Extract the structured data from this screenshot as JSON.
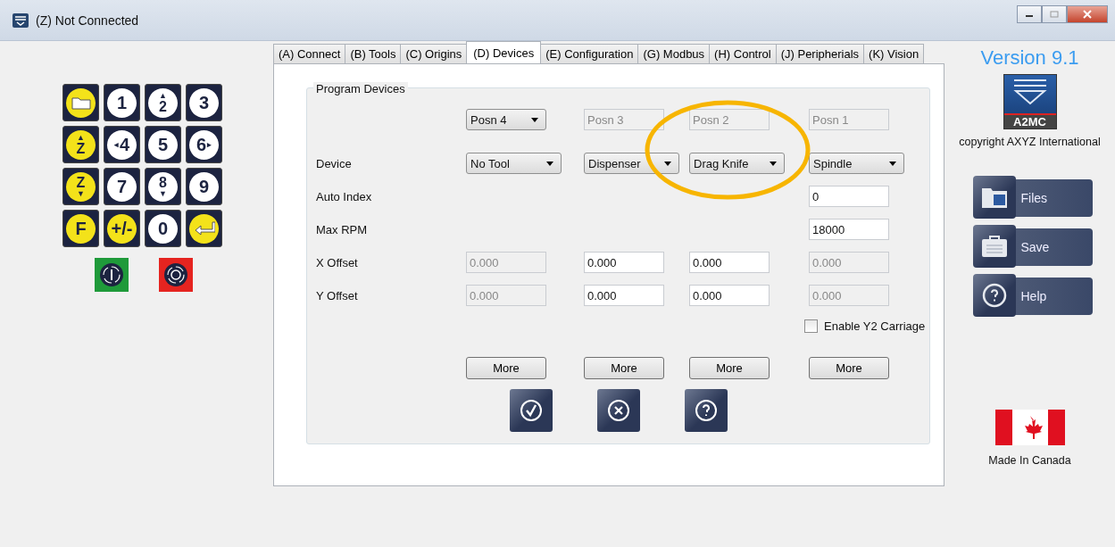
{
  "window": {
    "title": "(Z) Not Connected"
  },
  "keypad": {
    "keys": [
      {
        "kind": "folder"
      },
      {
        "kind": "plain",
        "label": "1"
      },
      {
        "kind": "plain",
        "label": "2",
        "above": "▲"
      },
      {
        "kind": "plain",
        "label": "3"
      },
      {
        "kind": "accent",
        "label": "Z",
        "above": "▲"
      },
      {
        "kind": "plain",
        "label": "4",
        "before": "◂"
      },
      {
        "kind": "plain",
        "label": "5"
      },
      {
        "kind": "plain",
        "label": "6",
        "after": "▸"
      },
      {
        "kind": "accent",
        "label": "Z",
        "below": "▼"
      },
      {
        "kind": "plain",
        "label": "7"
      },
      {
        "kind": "plain",
        "label": "8",
        "below": "▼"
      },
      {
        "kind": "plain",
        "label": "9"
      },
      {
        "kind": "accent",
        "label": "F"
      },
      {
        "kind": "accent",
        "label": "+/-"
      },
      {
        "kind": "plain",
        "label": "0"
      },
      {
        "kind": "enter"
      }
    ],
    "controls": [
      {
        "kind": "start"
      },
      {
        "kind": "stop"
      }
    ]
  },
  "tabs": [
    {
      "label": "(A) Connect",
      "selected": false
    },
    {
      "label": "(B) Tools",
      "selected": false
    },
    {
      "label": "(C) Origins",
      "selected": false
    },
    {
      "label": "(D) Devices",
      "selected": true
    },
    {
      "label": "(E) Configuration",
      "selected": false
    },
    {
      "label": "(G) Modbus",
      "selected": false
    },
    {
      "label": "(H) Control",
      "selected": false
    },
    {
      "label": "(J) Peripherials",
      "selected": false
    },
    {
      "label": "(K) Vision",
      "selected": false
    }
  ],
  "program_devices": {
    "title": "Program Devices",
    "rows": [
      {
        "cells": [
          {
            "kind": "dropdown",
            "value": "Posn 4"
          },
          {
            "kind": "field",
            "value": "Posn 3",
            "disabled": true
          },
          {
            "kind": "field",
            "value": "Posn 2",
            "disabled": true
          },
          {
            "kind": "field",
            "value": "Posn 1",
            "disabled": true
          }
        ]
      },
      {
        "label": "Device",
        "cells": [
          {
            "kind": "dropdown",
            "value": "No Tool"
          },
          {
            "kind": "dropdown",
            "value": "Dispenser"
          },
          {
            "kind": "dropdown",
            "value": "Drag Knife"
          },
          {
            "kind": "dropdown",
            "value": "Spindle"
          }
        ]
      },
      {
        "label": "Auto Index",
        "cells": [
          {
            "kind": "blank"
          },
          {
            "kind": "blank"
          },
          {
            "kind": "blank"
          },
          {
            "kind": "field",
            "value": "0",
            "disabled": false
          }
        ]
      },
      {
        "label": "Max RPM",
        "cells": [
          {
            "kind": "blank"
          },
          {
            "kind": "blank"
          },
          {
            "kind": "blank"
          },
          {
            "kind": "field",
            "value": "18000",
            "disabled": false
          }
        ]
      },
      {
        "label": "X Offset",
        "cells": [
          {
            "kind": "field",
            "value": "0.000",
            "disabled": true
          },
          {
            "kind": "field",
            "value": "0.000",
            "disabled": false
          },
          {
            "kind": "field",
            "value": "0.000",
            "disabled": false
          },
          {
            "kind": "field",
            "value": "0.000",
            "disabled": true
          }
        ]
      },
      {
        "label": "Y Offset",
        "cells": [
          {
            "kind": "field",
            "value": "0.000",
            "disabled": true
          },
          {
            "kind": "field",
            "value": "0.000",
            "disabled": false
          },
          {
            "kind": "field",
            "value": "0.000",
            "disabled": false
          },
          {
            "kind": "field",
            "value": "0.000",
            "disabled": true
          }
        ]
      }
    ],
    "checkbox": {
      "label": "Enable Y2 Carriage",
      "checked": false
    },
    "more_buttons": [
      "More",
      "More",
      "More",
      "More"
    ],
    "actions": [
      {
        "kind": "ok"
      },
      {
        "kind": "cancel"
      },
      {
        "kind": "help"
      }
    ]
  },
  "side": {
    "version": "Version 9.1",
    "logo_text": "A2MC",
    "copyright": "copyright AXYZ International",
    "buttons": [
      {
        "kind": "files",
        "label": "Files"
      },
      {
        "kind": "save",
        "label": "Save"
      },
      {
        "kind": "help",
        "label": "Help"
      }
    ],
    "made_in": "Made In Canada"
  }
}
